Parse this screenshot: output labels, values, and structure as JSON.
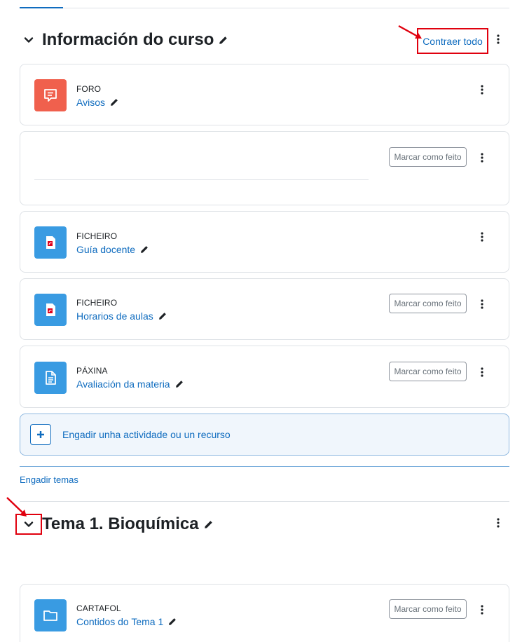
{
  "course_section": {
    "title": "Información do curso",
    "collapse_all_label": "Contraer todo"
  },
  "activities": [
    {
      "type": "FORO",
      "name": "Avisos",
      "icon": "forum-icon"
    },
    {
      "type": "",
      "name": "",
      "completion_label": "Marcar como feito"
    },
    {
      "type": "FICHEIRO",
      "name": "Guía docente",
      "icon": "pdf-file-icon"
    },
    {
      "type": "FICHEIRO",
      "name": "Horarios de aulas",
      "icon": "pdf-file-icon",
      "completion_label": "Marcar como feito"
    },
    {
      "type": "PÁXINA",
      "name": "Avaliación da materia",
      "icon": "page-icon",
      "completion_label": "Marcar como feito"
    }
  ],
  "add_activity_label": "Engadir unha actividade ou un recurso",
  "add_sections_label": "Engadir temas",
  "topic_section": {
    "title": "Tema 1. Bioquímica",
    "activities": [
      {
        "type": "CARTAFOL",
        "name": "Contidos do Tema 1",
        "icon": "folder-icon",
        "completion_label": "Marcar como feito"
      }
    ]
  },
  "colors": {
    "link": "#0f6cbf",
    "forum_icon_bg": "#f0604d",
    "resource_icon_bg": "#399be2",
    "annotation_red": "#e0000e"
  }
}
